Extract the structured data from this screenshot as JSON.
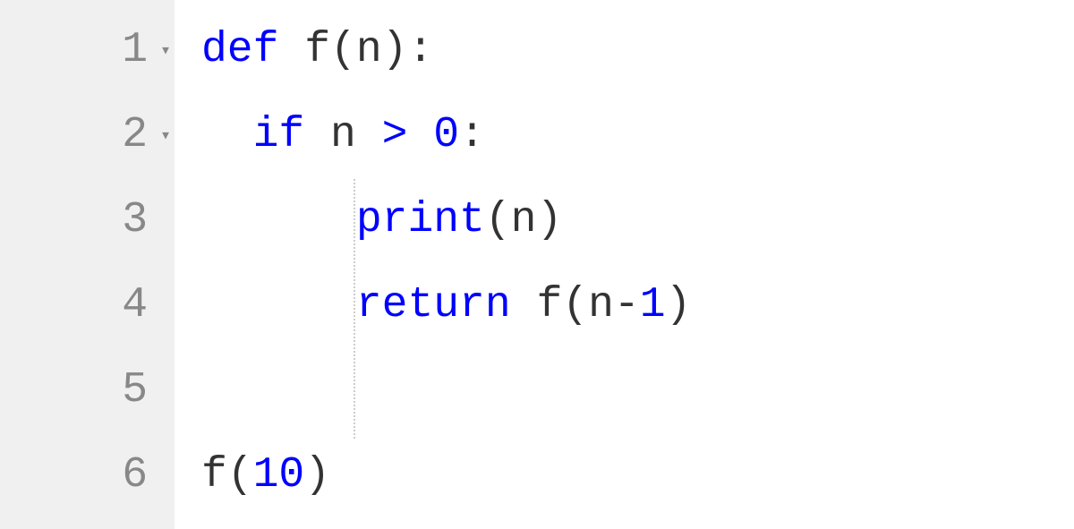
{
  "gutter": {
    "lines": [
      "1",
      "2",
      "3",
      "4",
      "5",
      "6"
    ],
    "fold_markers": [
      true,
      true,
      false,
      false,
      false,
      false
    ]
  },
  "code": {
    "line1": {
      "kw_def": "def",
      "space1": " ",
      "name": "f(n):",
      "plain_rest": ""
    },
    "line2": {
      "indent": "  ",
      "kw_if": "if",
      "space1": " ",
      "var": "n ",
      "op_gt": ">",
      "space2": " ",
      "num": "0",
      "colon": ":"
    },
    "line3": {
      "indent": "      ",
      "builtin": "print",
      "args": "(n)"
    },
    "line4": {
      "indent": "      ",
      "kw_return": "return",
      "space1": " ",
      "call": "f(n-",
      "num": "1",
      "close": ")"
    },
    "line5": {
      "content": ""
    },
    "line6": {
      "call": "f(",
      "num": "10",
      "close": ")"
    }
  }
}
